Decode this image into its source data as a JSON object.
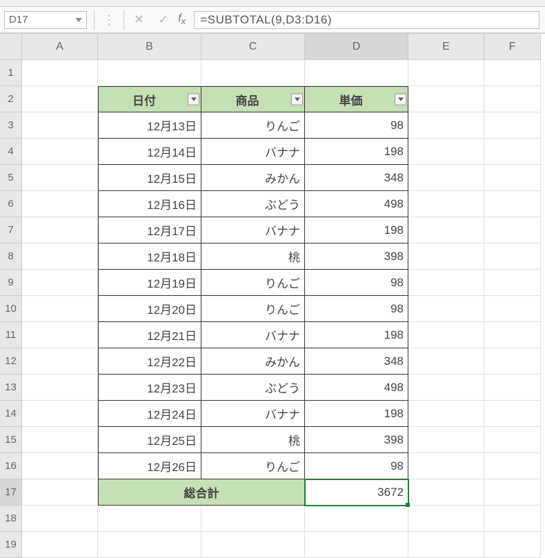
{
  "namebox": {
    "value": "D17"
  },
  "formula_bar": {
    "text": "=SUBTOTAL(9,D3:D16)"
  },
  "columns": [
    "A",
    "B",
    "C",
    "D",
    "E",
    "F"
  ],
  "row_labels": [
    1,
    2,
    3,
    4,
    5,
    6,
    7,
    8,
    9,
    10,
    11,
    12,
    13,
    14,
    15,
    16,
    17,
    18,
    19
  ],
  "headers": {
    "date": "日付",
    "product": "商品",
    "price": "単価"
  },
  "rows": [
    {
      "date": "12月13日",
      "product": "りんご",
      "price": 98
    },
    {
      "date": "12月14日",
      "product": "バナナ",
      "price": 198
    },
    {
      "date": "12月15日",
      "product": "みかん",
      "price": 348
    },
    {
      "date": "12月16日",
      "product": "ぶどう",
      "price": 498
    },
    {
      "date": "12月17日",
      "product": "バナナ",
      "price": 198
    },
    {
      "date": "12月18日",
      "product": "桃",
      "price": 398
    },
    {
      "date": "12月19日",
      "product": "りんご",
      "price": 98
    },
    {
      "date": "12月20日",
      "product": "りんご",
      "price": 98
    },
    {
      "date": "12月21日",
      "product": "バナナ",
      "price": 198
    },
    {
      "date": "12月22日",
      "product": "みかん",
      "price": 348
    },
    {
      "date": "12月23日",
      "product": "ぶどう",
      "price": 498
    },
    {
      "date": "12月24日",
      "product": "バナナ",
      "price": 198
    },
    {
      "date": "12月25日",
      "product": "桃",
      "price": 398
    },
    {
      "date": "12月26日",
      "product": "りんご",
      "price": 98
    }
  ],
  "total": {
    "label": "総合計",
    "value": 3672
  },
  "selected_cell": "D17"
}
